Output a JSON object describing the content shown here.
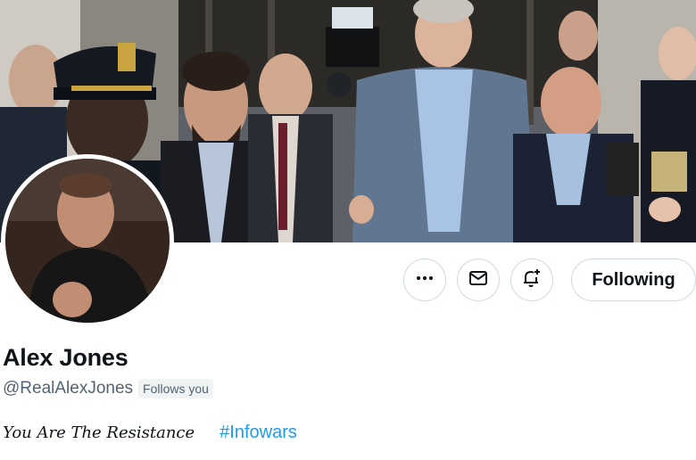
{
  "profile": {
    "name": "Alex Jones",
    "handle": "@RealAlexJones",
    "follows_you": "Follows you",
    "bio_text": "You Are The Resistance",
    "bio_hashtag": "#Infowars"
  },
  "actions": {
    "more_icon": "more-horizontal-icon",
    "message_icon": "envelope-icon",
    "notify_icon": "bell-plus-icon",
    "follow_label": "Following"
  },
  "colors": {
    "accent": "#1d9bf0",
    "text": "#0f1419",
    "muted": "#536471",
    "border": "#cfd9de",
    "badge_bg": "#eff3f4"
  }
}
